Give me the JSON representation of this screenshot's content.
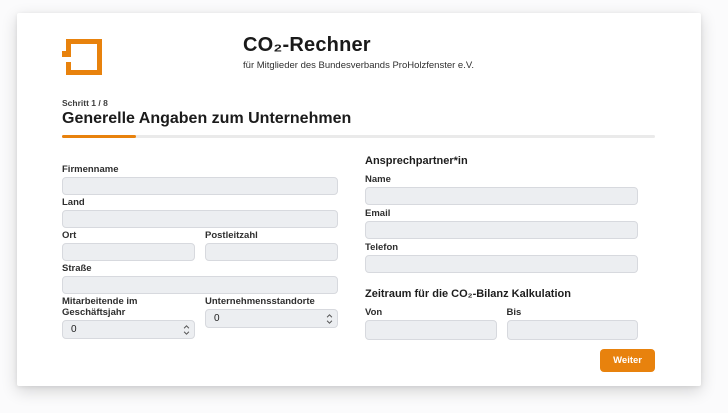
{
  "header": {
    "title": "CO₂-Rechner",
    "subtitle": "für Mitglieder des Bundesverbands ProHolzfenster e.V.",
    "logo": "orange-window-frame-logo"
  },
  "step": {
    "label": "Schritt 1 / 8",
    "heading": "Generelle Angaben zum Unternehmen",
    "progress_percent": 12.5
  },
  "colors": {
    "accent_orange": "#E8820D",
    "progress_track": "#EAEAEA",
    "input_bg": "#ECEEF1",
    "input_border": "#D7D9DE"
  },
  "form": {
    "left": {
      "firmenname": {
        "label": "Firmenname",
        "value": ""
      },
      "land": {
        "label": "Land",
        "value": ""
      },
      "ort": {
        "label": "Ort",
        "value": ""
      },
      "postleitzahl": {
        "label": "Postleitzahl",
        "value": ""
      },
      "strasse": {
        "label": "Straße",
        "value": ""
      },
      "mitarbeitende": {
        "label": "Mitarbeitende im Geschäftsjahr",
        "value": "0"
      },
      "standorte": {
        "label": "Unternehmensstandorte",
        "value": "0"
      }
    },
    "right": {
      "contact_heading": "Ansprechpartner*in",
      "name": {
        "label": "Name",
        "value": ""
      },
      "email": {
        "label": "Email",
        "value": ""
      },
      "telefon": {
        "label": "Telefon",
        "value": ""
      },
      "period_heading": "Zeitraum für die CO₂-Bilanz Kalkulation",
      "von": {
        "label": "Von",
        "value": ""
      },
      "bis": {
        "label": "Bis",
        "value": ""
      }
    }
  },
  "footer": {
    "next_label": "Weiter"
  }
}
